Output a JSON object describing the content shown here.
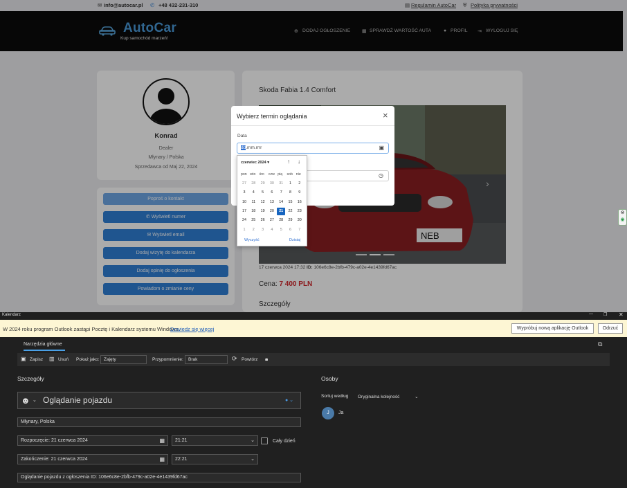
{
  "browser": {
    "topbar": {
      "email": "info@autocar.pl",
      "phone": "+48 432-231-310",
      "terms": "Regulamin AutoCar",
      "privacy": "Polityka prywatności"
    },
    "logo": {
      "title": "AutoCar",
      "tagline": "Kup samochód marzeń!"
    },
    "nav": {
      "add": "DODAJ OGŁOSZENIE",
      "check": "SPRAWDŹ WARTOŚĆ AUTA",
      "profile": "PROFIL",
      "logout": "WYLOGUJ SIĘ"
    },
    "profile": {
      "name": "Konrad",
      "role": "Dealer",
      "location": "Młynary / Polska",
      "since": "Sprzedawca od Maj 22, 2024"
    },
    "buttons": {
      "contact": "Poproś o kontakt",
      "phone": "Wyświetl numer",
      "email": "Wyświetl email",
      "calendar": "Dodaj wizytę do kalendarza",
      "review": "Dodaj opinię do ogłoszenia",
      "price": "Powiadom o zmianie ceny"
    },
    "listing": {
      "title": "Skoda Fabia 1.4 Comfort",
      "meta_date": "17 czerwca 2024 17:32",
      "meta_id_label": "ID:",
      "meta_id": "106e6c8e-2bfb-479c-a02e-4e1439fd67ac",
      "price_label": "Cena:",
      "price": "7 400 PLN",
      "details": "Szczegóły",
      "plate": "NEB"
    },
    "modal": {
      "title": "Wybierz termin oglądania",
      "date_label": "Data",
      "date_sel": "dd",
      "date_rest": ".mm.rrrr"
    },
    "datepicker": {
      "month": "czerwiec 2024 ▾",
      "weekdays": [
        "pon",
        "wto",
        "śro",
        "czw",
        "pią",
        "sob",
        "nie"
      ],
      "weeks": [
        [
          "27",
          "28",
          "29",
          "30",
          "31",
          "1",
          "2"
        ],
        [
          "3",
          "4",
          "5",
          "6",
          "7",
          "8",
          "9"
        ],
        [
          "10",
          "11",
          "12",
          "13",
          "14",
          "15",
          "16"
        ],
        [
          "17",
          "18",
          "19",
          "20",
          "21",
          "22",
          "23"
        ],
        [
          "24",
          "25",
          "26",
          "27",
          "28",
          "29",
          "30"
        ],
        [
          "1",
          "2",
          "3",
          "4",
          "5",
          "6",
          "7"
        ]
      ],
      "clear": "Wyczyść",
      "today": "Dzisiaj"
    }
  },
  "outlook": {
    "window_title": "Kalendarz",
    "info": {
      "text": "W 2024 roku program Outlook zastąpi Pocztę i Kalendarz systemu Windows.",
      "link": "Dowiedz się więcej",
      "try_btn": "Wypróbuj nową aplikację Outlook",
      "dismiss_btn": "Odrzuć"
    },
    "ribbon": {
      "tab": "Narzędzia główne",
      "save": "Zapisz",
      "delete": "Usuń",
      "show_as_label": "Pokaż jako:",
      "show_as": "Zajęty",
      "reminder_label": "Przypomnienie:",
      "reminder": "Brak",
      "repeat": "Powtórz"
    },
    "details": {
      "heading": "Szczegóły",
      "title": "Oglądanie pojazdu",
      "location": "Młynary, Polska",
      "start_label": "Rozpoczęcie:",
      "start_date": "21 czerwca 2024",
      "start_time": "21:21",
      "all_day": "Cały dzień",
      "end_label": "Zakończenie:",
      "end_date": "21 czerwca 2024",
      "end_time": "22:21",
      "description": "Oglądanie pojazdu z ogłoszenia ID: 106e6c8e-2bfb-479c-a02e-4e1439fd67ac"
    },
    "people": {
      "heading": "Osoby",
      "sort_label": "Sortuj według",
      "sort_value": "Oryginalna kolejność",
      "person_initial": "J",
      "person_name": "Ja"
    }
  }
}
